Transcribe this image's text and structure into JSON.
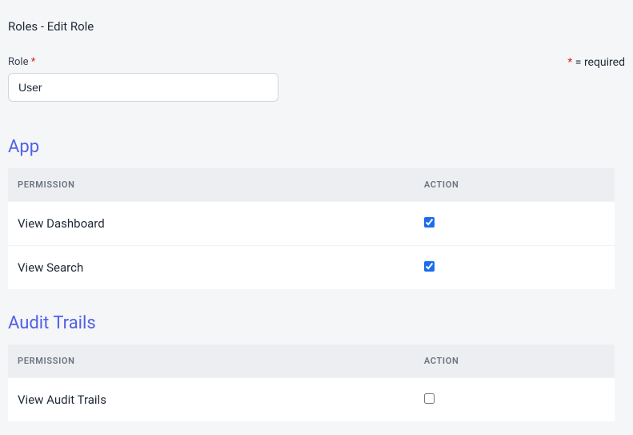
{
  "page": {
    "title": "Roles - Edit Role"
  },
  "form": {
    "role_label": "Role",
    "role_value": "User",
    "required_note": "= required"
  },
  "tables": {
    "header_permission": "PERMISSION",
    "header_action": "ACTION"
  },
  "sections": [
    {
      "title": "App",
      "rows": [
        {
          "label": "View Dashboard",
          "checked": true
        },
        {
          "label": "View Search",
          "checked": true
        }
      ]
    },
    {
      "title": "Audit Trails",
      "rows": [
        {
          "label": "View Audit Trails",
          "checked": false
        }
      ]
    }
  ]
}
